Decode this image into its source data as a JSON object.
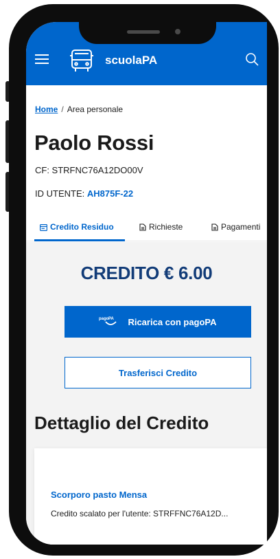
{
  "header": {
    "app_title": "scuolaPA",
    "menu_icon": "hamburger-icon",
    "logo_icon": "bus-icon",
    "search_icon": "search-icon",
    "brand_color": "#0066cc"
  },
  "breadcrumb": {
    "home": "Home",
    "separator": "/",
    "current": "Area personale"
  },
  "user": {
    "name": "Paolo Rossi",
    "cf_label": "CF: STRFNC76A12DO00V",
    "id_label": "ID UTENTE:",
    "id_value": "AH875F-22"
  },
  "tabs": [
    {
      "label": "Credito Residuo",
      "icon": "wallet-icon",
      "active": true
    },
    {
      "label": "Richieste",
      "icon": "document-icon",
      "active": false
    },
    {
      "label": "Pagamenti",
      "icon": "document-icon",
      "active": false
    }
  ],
  "credit": {
    "label": "CREDITO € 6.00"
  },
  "actions": {
    "primary_label": "Ricarica con pagoPA",
    "primary_logo_text": "pagoPA",
    "secondary_label": "Trasferisci Credito"
  },
  "detail": {
    "section_title": "Dettaglio del Credito",
    "item_title": "Scorporo pasto Mensa",
    "item_text": "Credito scalato per l'utente: STRFFNC76A12D..."
  }
}
